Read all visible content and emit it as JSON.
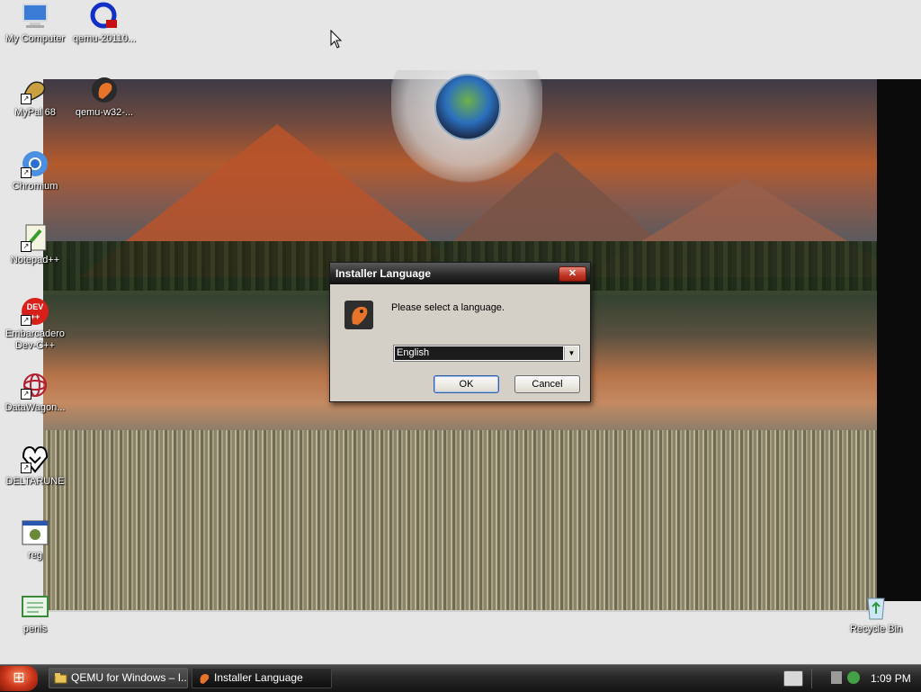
{
  "desktop": {
    "icons": [
      {
        "label": "My Computer"
      },
      {
        "label": "qemu-20110..."
      },
      {
        "label": "MyPal 68"
      },
      {
        "label": "qemu-w32-..."
      },
      {
        "label": "Chromium"
      },
      {
        "label": "Notepad++"
      },
      {
        "label": "Embarcadero Dev-C++"
      },
      {
        "label": "DataWagon..."
      },
      {
        "label": "DELTARUNE"
      },
      {
        "label": "reg"
      },
      {
        "label": "penis"
      },
      {
        "label": "Recycle Bin"
      }
    ]
  },
  "dialog": {
    "title": "Installer Language",
    "close_glyph": "✕",
    "message": "Please select a language.",
    "language": "English",
    "ok_label": "OK",
    "cancel_label": "Cancel"
  },
  "taskbar": {
    "start_glyph": "⊞",
    "tasks": [
      {
        "label": "QEMU for Windows – I..."
      },
      {
        "label": "Installer Language"
      }
    ],
    "clock": "1:09 PM"
  }
}
